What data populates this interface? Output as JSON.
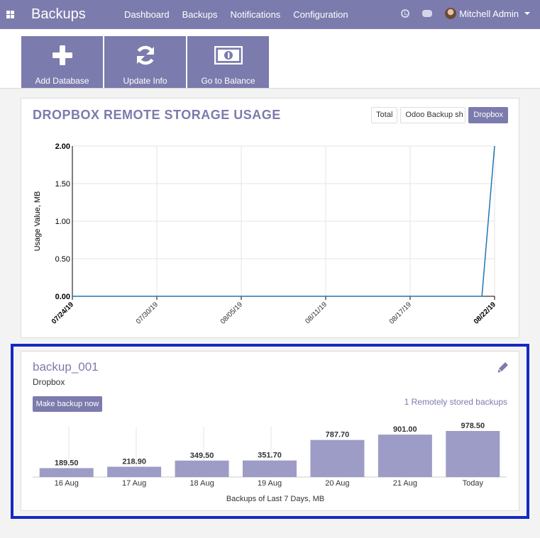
{
  "navbar": {
    "brand": "Backups",
    "menu": [
      "Dashboard",
      "Backups",
      "Notifications",
      "Configuration"
    ],
    "user": "Mitchell Admin"
  },
  "toolbar": {
    "buttons": [
      {
        "label": "Add Database",
        "icon": "plus-icon"
      },
      {
        "label": "Update Info",
        "icon": "refresh-icon"
      },
      {
        "label": "Go to Balance",
        "icon": "money-icon"
      }
    ]
  },
  "usage": {
    "title": "DROPBOX REMOTE STORAGE USAGE",
    "filters": [
      {
        "label": "Total",
        "active": false
      },
      {
        "label": "Odoo Backup sh",
        "active": false
      },
      {
        "label": "Dropbox",
        "active": true
      }
    ]
  },
  "backup": {
    "name": "backup_001",
    "storage": "Dropbox",
    "make_backup_label": "Make backup now",
    "remote_link": "1 Remotely stored backups"
  },
  "colors": {
    "accent": "#7c7bad",
    "line": "#1f77b4",
    "bar": "#9d9cc7",
    "highlight": "#1329c4"
  },
  "chart_data": [
    {
      "type": "line",
      "title": "",
      "ylabel": "Usage Value, MB",
      "xlabel": "",
      "ylim": [
        0,
        2
      ],
      "yticks": [
        "0.00",
        "0.50",
        "1.00",
        "1.50",
        "2.00"
      ],
      "x": [
        "07/24/19",
        "07/30/19",
        "08/05/19",
        "08/11/19",
        "08/17/19",
        "08/22/19"
      ],
      "x_bold": [
        "07/24/19",
        "08/22/19"
      ],
      "series": [
        {
          "name": "Dropbox",
          "points": [
            [
              0,
              0
            ],
            [
              0.97,
              0
            ],
            [
              1,
              2
            ]
          ]
        }
      ],
      "grid": true
    },
    {
      "type": "bar",
      "xlabel": "Backups of Last 7 Days, MB",
      "categories": [
        "16 Aug",
        "17 Aug",
        "18 Aug",
        "19 Aug",
        "20 Aug",
        "21 Aug",
        "Today"
      ],
      "values": [
        189.5,
        218.9,
        349.5,
        351.7,
        787.7,
        901.0,
        978.5
      ],
      "value_labels": [
        "189.50",
        "218.90",
        "349.50",
        "351.70",
        "787.70",
        "901.00",
        "978.50"
      ],
      "ylim": [
        0,
        978.5
      ]
    }
  ]
}
